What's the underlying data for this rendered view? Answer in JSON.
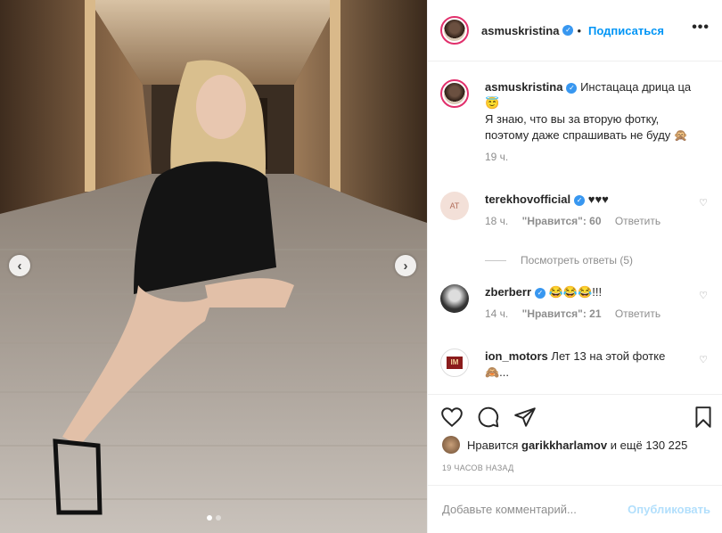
{
  "post": {
    "author": "asmuskristina",
    "follow_label": "Подписаться",
    "more_icon": "•••"
  },
  "caption": {
    "author": "asmuskristina",
    "line1": "Инстацаца дрица ца",
    "emoji1": "😇",
    "line2": "Я знаю, что вы за вторую фотку,",
    "line3": "поэтому даже спрашивать не буду",
    "trailing": "🙊",
    "time": "19 ч."
  },
  "comments": [
    {
      "avatar_text": "AT",
      "user": "terekhovofficial",
      "text": "♥♥♥",
      "time": "18 ч.",
      "likes": "\"Нравится\": 60",
      "reply": "Ответить"
    },
    {
      "user": "zberberr",
      "text": "😂😂😂!!!",
      "time": "14 ч.",
      "likes": "\"Нравится\": 21",
      "reply": "Ответить"
    },
    {
      "avatar_text": "IM",
      "user": "ion_motors",
      "text": "Лет 13 на этой фотке",
      "text2": "🙈..."
    }
  ],
  "view_replies": "Посмотреть ответы (5)",
  "likes": {
    "prefix": "Нравится",
    "user": "garikkharlamov",
    "suffix": "и ещё 130 225"
  },
  "timestamp": "19 ЧАСОВ НАЗАД",
  "comment_box": {
    "placeholder": "Добавьте комментарий...",
    "post_label": "Опубликовать"
  },
  "carousel": {
    "prev": "‹",
    "next": "›"
  },
  "colors": {
    "accent": "#0095f6",
    "verified": "#3897f0",
    "muted": "#8e8e8e"
  }
}
